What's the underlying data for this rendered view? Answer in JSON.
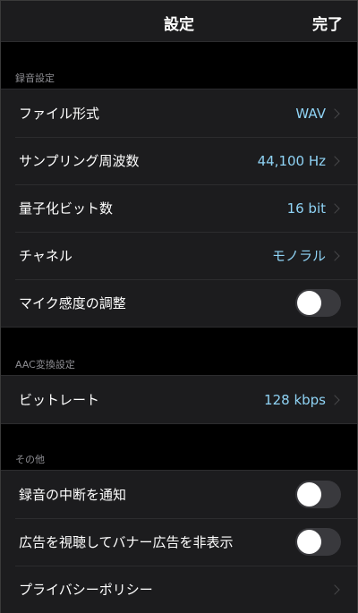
{
  "navbar": {
    "title": "設定",
    "done_label": "完了"
  },
  "sections": {
    "recording": {
      "header": "録音設定",
      "file_format": {
        "label": "ファイル形式",
        "value": "WAV"
      },
      "sampling_rate": {
        "label": "サンプリング周波数",
        "value": "44,100 Hz"
      },
      "bit_depth": {
        "label": "量子化ビット数",
        "value": "16 bit"
      },
      "channel": {
        "label": "チャネル",
        "value": "モノラル"
      },
      "mic_sensitivity": {
        "label": "マイク感度の調整",
        "enabled": false
      }
    },
    "aac": {
      "header": "AAC変換設定",
      "bitrate": {
        "label": "ビットレート",
        "value": "128 kbps"
      }
    },
    "other": {
      "header": "その他",
      "interruption_notify": {
        "label": "録音の中断を通知",
        "enabled": false
      },
      "hide_banner_ads": {
        "label": "広告を視聴してバナー広告を非表示",
        "enabled": false
      },
      "privacy_policy": {
        "label": "プライバシーポリシー"
      }
    }
  },
  "colors": {
    "accent_value": "#8fd3f5",
    "background": "#000000",
    "cell_background": "#1c1c1e",
    "toggle_off": "#39393d"
  }
}
